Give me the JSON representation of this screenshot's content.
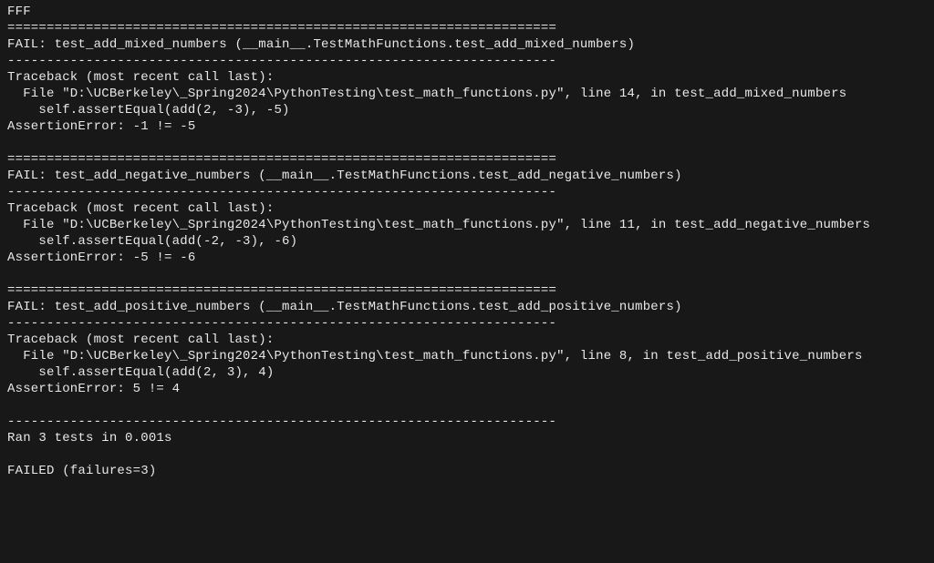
{
  "lines": {
    "l0": "FFF",
    "l1": "======================================================================",
    "l2": "FAIL: test_add_mixed_numbers (__main__.TestMathFunctions.test_add_mixed_numbers)",
    "l3": "----------------------------------------------------------------------",
    "l4": "Traceback (most recent call last):",
    "l5": "  File \"D:\\UCBerkeley\\_Spring2024\\PythonTesting\\test_math_functions.py\", line 14, in test_add_mixed_numbers",
    "l6": "    self.assertEqual(add(2, -3), -5)",
    "l7": "AssertionError: -1 != -5",
    "l8": "",
    "l9": "======================================================================",
    "l10": "FAIL: test_add_negative_numbers (__main__.TestMathFunctions.test_add_negative_numbers)",
    "l11": "----------------------------------------------------------------------",
    "l12": "Traceback (most recent call last):",
    "l13": "  File \"D:\\UCBerkeley\\_Spring2024\\PythonTesting\\test_math_functions.py\", line 11, in test_add_negative_numbers",
    "l14": "    self.assertEqual(add(-2, -3), -6)",
    "l15": "AssertionError: -5 != -6",
    "l16": "",
    "l17": "======================================================================",
    "l18": "FAIL: test_add_positive_numbers (__main__.TestMathFunctions.test_add_positive_numbers)",
    "l19": "----------------------------------------------------------------------",
    "l20": "Traceback (most recent call last):",
    "l21": "  File \"D:\\UCBerkeley\\_Spring2024\\PythonTesting\\test_math_functions.py\", line 8, in test_add_positive_numbers",
    "l22": "    self.assertEqual(add(2, 3), 4)",
    "l23": "AssertionError: 5 != 4",
    "l24": "",
    "l25": "----------------------------------------------------------------------",
    "l26": "Ran 3 tests in 0.001s",
    "l27": "",
    "l28": "FAILED (failures=3)"
  }
}
